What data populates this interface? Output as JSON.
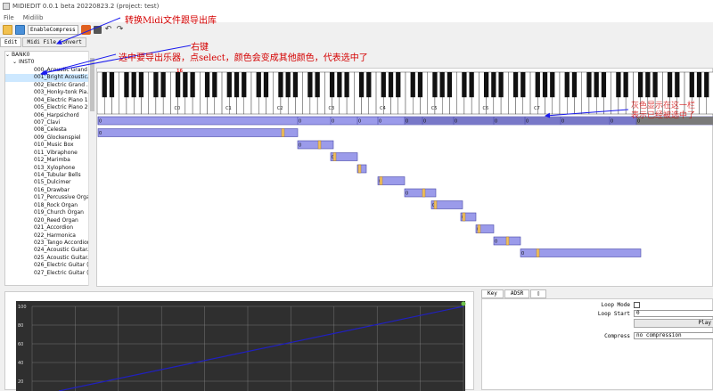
{
  "window": {
    "title": "MIDIEDIT 0.0.1 beta 20220823.2 (project: test)"
  },
  "menu": [
    "File",
    "Midilib"
  ],
  "toolbar": {
    "enable_compress": "EnableCompress"
  },
  "tabs": [
    "Edit",
    "Midi File Convert"
  ],
  "tree": {
    "bank": "BANK0",
    "inst": "INST0",
    "items": [
      "000_Acoustic Grand ...",
      "001_Bright Acoustic...",
      "002_Electric Grand ...",
      "003_Honky-tonk Pia...",
      "004_Electric Piano 1",
      "005_Electric Piano 2",
      "006_Harpsichord",
      "007_Clavi",
      "008_Celesta",
      "009_Glockenspiel",
      "010_Music Box",
      "011_Vibraphone",
      "012_Marimba",
      "013_Xylophone",
      "014_Tubular Bells",
      "015_Dulcimer",
      "016_Drawbar",
      "017_Percussive Organ",
      "018_Rock Organ",
      "019_Church Organ",
      "020_Reed Organ",
      "021_Accordion",
      "022_Harmonica",
      "023_Tango Accordion",
      "024_Acoustic Guitar...",
      "025_Acoustic Guitar...",
      "026_Electric Guitar (...",
      "027_Electric Guitar (..."
    ],
    "selected_index": 1
  },
  "piano": {
    "octave_labels": [
      "C0",
      "C1",
      "C2",
      "C3",
      "C4",
      "C5",
      "C6",
      "C7"
    ],
    "marker": "16"
  },
  "regions": {
    "top_row_label": "0",
    "row_label": "0"
  },
  "envelope": {
    "y_labels": [
      "100",
      "80",
      "60",
      "40",
      "20"
    ]
  },
  "bottom_right": {
    "tabs": [
      "Key",
      "ADSR",
      "▯"
    ],
    "loop_mode_label": "Loop Mode",
    "loop_start_label": "Loop Start",
    "loop_start_value": "0",
    "play_label": "Play",
    "compress_label": "Compress",
    "compress_value": "no compression"
  },
  "annotations": {
    "a1": "转换Midi文件跟导出库",
    "a2": "右键",
    "a3": "选中要导出乐器，点select，颜色会变成其他颜色，代表选中了",
    "a4_line1": "灰色显示在这一栏",
    "a4_line2": "表示已经被选中了"
  },
  "colors": {
    "region_fill": "#9b9bea",
    "region_border": "#4646a8",
    "region_handle": "#f0c060",
    "annotation": "#d40000",
    "envelope_line": "#2020c0",
    "envelope_bg": "#2f2f2f"
  }
}
